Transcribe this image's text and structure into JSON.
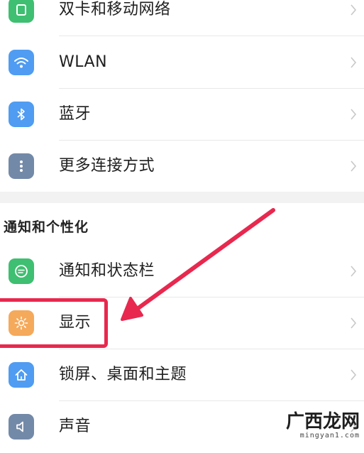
{
  "network_section": {
    "items": [
      {
        "label": "双卡和移动网络",
        "icon": "sim-card-icon",
        "color": "#3fbf71"
      },
      {
        "label": "WLAN",
        "icon": "wifi-icon",
        "color": "#4f9cf2"
      },
      {
        "label": "蓝牙",
        "icon": "bluetooth-icon",
        "color": "#4f9cf2"
      },
      {
        "label": "更多连接方式",
        "icon": "more-dots-icon",
        "color": "#7389a8"
      }
    ]
  },
  "personalization_section": {
    "title": "通知和个性化",
    "items": [
      {
        "label": "通知和状态栏",
        "icon": "notification-icon",
        "color": "#3fbf71"
      },
      {
        "label": "显示",
        "icon": "brightness-icon",
        "color": "#f5a95b"
      },
      {
        "label": "锁屏、桌面和主题",
        "icon": "home-icon",
        "color": "#4f9cf2"
      },
      {
        "label": "声音",
        "icon": "speaker-icon",
        "color": "#7389a8"
      }
    ]
  },
  "annotation": {
    "highlight_color": "#e8284e",
    "arrow_color": "#e8284e"
  },
  "watermark": {
    "name": "广西龙网",
    "url": "mingyan1.com"
  }
}
